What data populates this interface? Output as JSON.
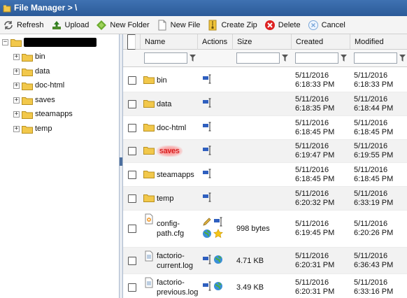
{
  "window": {
    "title": "File Manager > \\"
  },
  "toolbar": {
    "refresh": "Refresh",
    "upload": "Upload",
    "new_folder": "New Folder",
    "new_file": "New File",
    "create_zip": "Create Zip",
    "delete": "Delete",
    "cancel": "Cancel"
  },
  "tree": {
    "items": [
      {
        "label": "bin"
      },
      {
        "label": "data"
      },
      {
        "label": "doc-html"
      },
      {
        "label": "saves"
      },
      {
        "label": "steamapps"
      },
      {
        "label": "temp"
      }
    ]
  },
  "grid": {
    "headers": {
      "name": "Name",
      "actions": "Actions",
      "size": "Size",
      "created": "Created",
      "modified": "Modified"
    },
    "rows": [
      {
        "name": "bin",
        "type": "folder",
        "size": "",
        "created_d": "5/11/2016",
        "created_t": "6:18:33 PM",
        "modified_d": "5/11/2016",
        "modified_t": "6:18:33 PM",
        "actions": [
          "rename-icon"
        ]
      },
      {
        "name": "data",
        "type": "folder",
        "size": "",
        "created_d": "5/11/2016",
        "created_t": "6:18:35 PM",
        "modified_d": "5/11/2016",
        "modified_t": "6:18:44 PM",
        "actions": [
          "rename-icon"
        ]
      },
      {
        "name": "doc-html",
        "type": "folder",
        "size": "",
        "created_d": "5/11/2016",
        "created_t": "6:18:45 PM",
        "modified_d": "5/11/2016",
        "modified_t": "6:18:45 PM",
        "actions": [
          "rename-icon"
        ]
      },
      {
        "name": "saves",
        "type": "folder",
        "size": "",
        "created_d": "5/11/2016",
        "created_t": "6:19:47 PM",
        "modified_d": "5/11/2016",
        "modified_t": "6:19:55 PM",
        "actions": [
          "rename-icon"
        ]
      },
      {
        "name": "steamapps",
        "type": "folder",
        "size": "",
        "created_d": "5/11/2016",
        "created_t": "6:18:45 PM",
        "modified_d": "5/11/2016",
        "modified_t": "6:18:45 PM",
        "actions": [
          "rename-icon"
        ]
      },
      {
        "name": "temp",
        "type": "folder",
        "size": "",
        "created_d": "5/11/2016",
        "created_t": "6:20:32 PM",
        "modified_d": "5/11/2016",
        "modified_t": "6:33:19 PM",
        "actions": [
          "rename-icon"
        ]
      },
      {
        "name1": "config-",
        "name2": "path.cfg",
        "type": "cfg",
        "size": "998 bytes",
        "created_d": "5/11/2016",
        "created_t": "6:19:45 PM",
        "modified_d": "5/11/2016",
        "modified_t": "6:20:26 PM",
        "actions": [
          "edit-icon",
          "rename-icon",
          "globe-icon",
          "star-icon"
        ]
      },
      {
        "name1": "factorio-",
        "name2": "current.log",
        "type": "log",
        "size": "4.71 KB",
        "created_d": "5/11/2016",
        "created_t": "6:20:31 PM",
        "modified_d": "5/11/2016",
        "modified_t": "6:36:43 PM",
        "actions": [
          "rename-icon",
          "globe-icon"
        ]
      },
      {
        "name1": "factorio-",
        "name2": "previous.log",
        "type": "log",
        "size": "3.49 KB",
        "created_d": "5/11/2016",
        "created_t": "6:20:31 PM",
        "modified_d": "5/11/2016",
        "modified_t": "6:33:16 PM",
        "actions": [
          "rename-icon",
          "globe-icon"
        ]
      }
    ]
  },
  "colors": {
    "title_bar": "#2f62a6",
    "highlight": "#ff6a6a",
    "folder": "#f2c84b"
  }
}
